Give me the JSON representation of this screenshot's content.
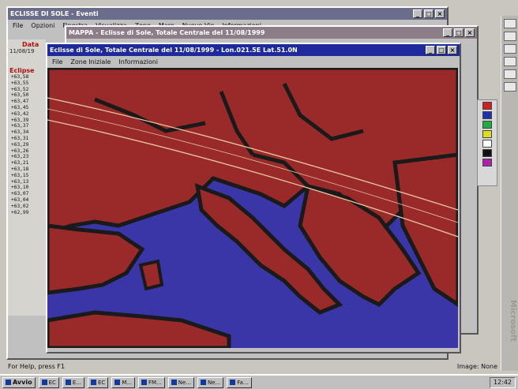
{
  "main_window": {
    "title": "ECLISSE DI SOLE - Eventi",
    "menu": [
      "File",
      "Opzioni",
      "Finestra",
      "Visualizza",
      "Zone",
      "Mare",
      "Nuove Vie",
      "Informazioni"
    ]
  },
  "mappa_window": {
    "title": "MAPPA - Eclisse di Sole, Totale Centrale del 11/08/1999"
  },
  "eclipse_window": {
    "title": "Eclisse di Sole, Totale Centrale del 11/08/1999 - Lon.021.5E Lat.51.0N",
    "menu": [
      "File",
      "Zone Iniziale",
      "Informazioni"
    ],
    "controls": [
      "_",
      "□",
      "×"
    ]
  },
  "left_panel": {
    "data_label": "Data",
    "date": "11/08/19",
    "eclipse_label": "Eclipse",
    "latitudes": [
      "+63,58",
      "+63,55",
      "+63,52",
      "+63,50",
      "+63,47",
      "+63,45",
      "+63,42",
      "+63,39",
      "+63,37",
      "+63,34",
      "+63,31",
      "+63,29",
      "+63,26",
      "+63,23",
      "+63,21",
      "+63,18",
      "+63,15",
      "+63,13",
      "+63,10",
      "+63,07",
      "+63,04",
      "+63,02",
      "+62,99"
    ]
  },
  "status_bar": {
    "left": "For Help, press F1",
    "right": "Image: None"
  },
  "taskbar": {
    "start": "Avvio",
    "items": [
      "EC",
      "E...",
      "EC",
      "M...",
      "FM...",
      "Ne...",
      "Ne...",
      "Fa..."
    ],
    "clock": "12:42"
  },
  "sidebar": {
    "office_label": "Microsoft"
  },
  "colors": {
    "land": "#9a2a2a",
    "sea": "#3a36a8",
    "border": "#1a1a1a",
    "path": "#e8c8a0"
  }
}
